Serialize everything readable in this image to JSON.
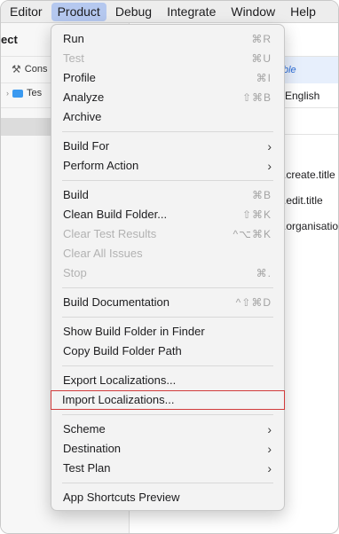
{
  "menubar": [
    {
      "label": "Editor",
      "active": false
    },
    {
      "label": "Product",
      "active": true
    },
    {
      "label": "Debug",
      "active": false
    },
    {
      "label": "Integrate",
      "active": false
    },
    {
      "label": "Window",
      "active": false
    },
    {
      "label": "Help",
      "active": false
    }
  ],
  "background": {
    "title": "ect",
    "row1": "Cons",
    "row2": "Tes",
    "right_items": [
      "ble",
      "English",
      ".create.title",
      ".edit.title",
      ".organisation"
    ]
  },
  "menu": {
    "items": [
      {
        "label": "Run",
        "shortcut": "⌘R",
        "disabled": false
      },
      {
        "label": "Test",
        "shortcut": "⌘U",
        "disabled": true
      },
      {
        "label": "Profile",
        "shortcut": "⌘I",
        "disabled": false
      },
      {
        "label": "Analyze",
        "shortcut": "⇧⌘B",
        "disabled": false
      },
      {
        "label": "Archive",
        "shortcut": "",
        "disabled": false
      },
      {
        "label": "Build For",
        "submenu": true
      },
      {
        "label": "Perform Action",
        "submenu": true
      },
      {
        "label": "Build",
        "shortcut": "⌘B",
        "disabled": false
      },
      {
        "label": "Clean Build Folder...",
        "shortcut": "⇧⌘K",
        "disabled": false
      },
      {
        "label": "Clear Test Results",
        "shortcut": "^⌥⌘K",
        "disabled": true
      },
      {
        "label": "Clear All Issues",
        "shortcut": "",
        "disabled": true
      },
      {
        "label": "Stop",
        "shortcut": "⌘.",
        "disabled": true
      },
      {
        "label": "Build Documentation",
        "shortcut": "^⇧⌘D",
        "disabled": false
      },
      {
        "label": "Show Build Folder in Finder",
        "shortcut": "",
        "disabled": false
      },
      {
        "label": "Copy Build Folder Path",
        "shortcut": "",
        "disabled": false
      },
      {
        "label": "Export Localizations...",
        "shortcut": "",
        "disabled": false
      },
      {
        "label": "Import Localizations...",
        "shortcut": "",
        "disabled": false
      },
      {
        "label": "Scheme",
        "submenu": true
      },
      {
        "label": "Destination",
        "submenu": true
      },
      {
        "label": "Test Plan",
        "submenu": true
      },
      {
        "label": "App Shortcuts Preview",
        "shortcut": "",
        "disabled": false
      }
    ]
  }
}
